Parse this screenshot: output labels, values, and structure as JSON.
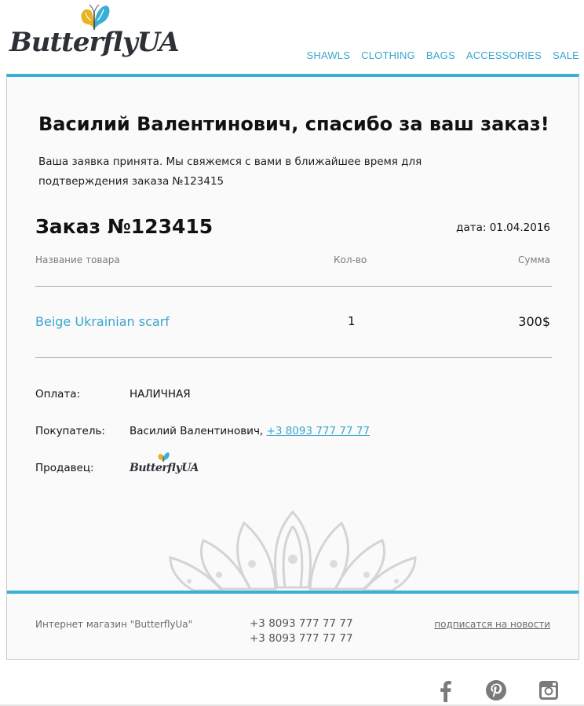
{
  "brand": {
    "logo_text": "ButterflyUA",
    "colors": {
      "accent": "#3aafd6",
      "link": "#3aa6cf",
      "logo_text": "#2d3037",
      "butterfly_yellow": "#e9b21f",
      "butterfly_blue": "#3aafd6"
    }
  },
  "nav": {
    "items": [
      {
        "label": "SHAWLS"
      },
      {
        "label": "CLOTHING"
      },
      {
        "label": "BAGS"
      },
      {
        "label": "ACCESSORIES"
      },
      {
        "label": "SALE"
      }
    ]
  },
  "confirmation": {
    "title": "Василий Валентинович, спасибо за ваш заказ!",
    "message": "Ваша заявка принята. Мы свяжемся с вами в ближайшее время для подтверждения заказа №123415"
  },
  "order": {
    "title": "Заказ №123415",
    "date_label": "дата:",
    "date_value": "01.04.2016",
    "columns": {
      "name": "Название товара",
      "qty": "Кол-во",
      "sum": "Сумма"
    },
    "items": [
      {
        "name": "Beige Ukrainian scarf",
        "qty": "1",
        "sum": "300$"
      }
    ]
  },
  "details": {
    "payment_label": "Оплата:",
    "payment_value": "НАЛИЧНАЯ",
    "buyer_label": "Покупатель:",
    "buyer_name": "Василий Валентинович,",
    "buyer_phone": "+3 8093 777 77 77",
    "seller_label": "Продавец:",
    "seller_logo_text": "ButterflyUA"
  },
  "footer": {
    "shop": "Интернет магазин \"ButterflyUa\"",
    "phones": [
      "+3 8093 777 77 77",
      "+3 8093 777 77 77"
    ],
    "subscribe": "подписатся на новости"
  },
  "social": {
    "icons": [
      "facebook-icon",
      "pinterest-icon",
      "instagram-icon"
    ],
    "icon_color": "#7a7a7a"
  }
}
